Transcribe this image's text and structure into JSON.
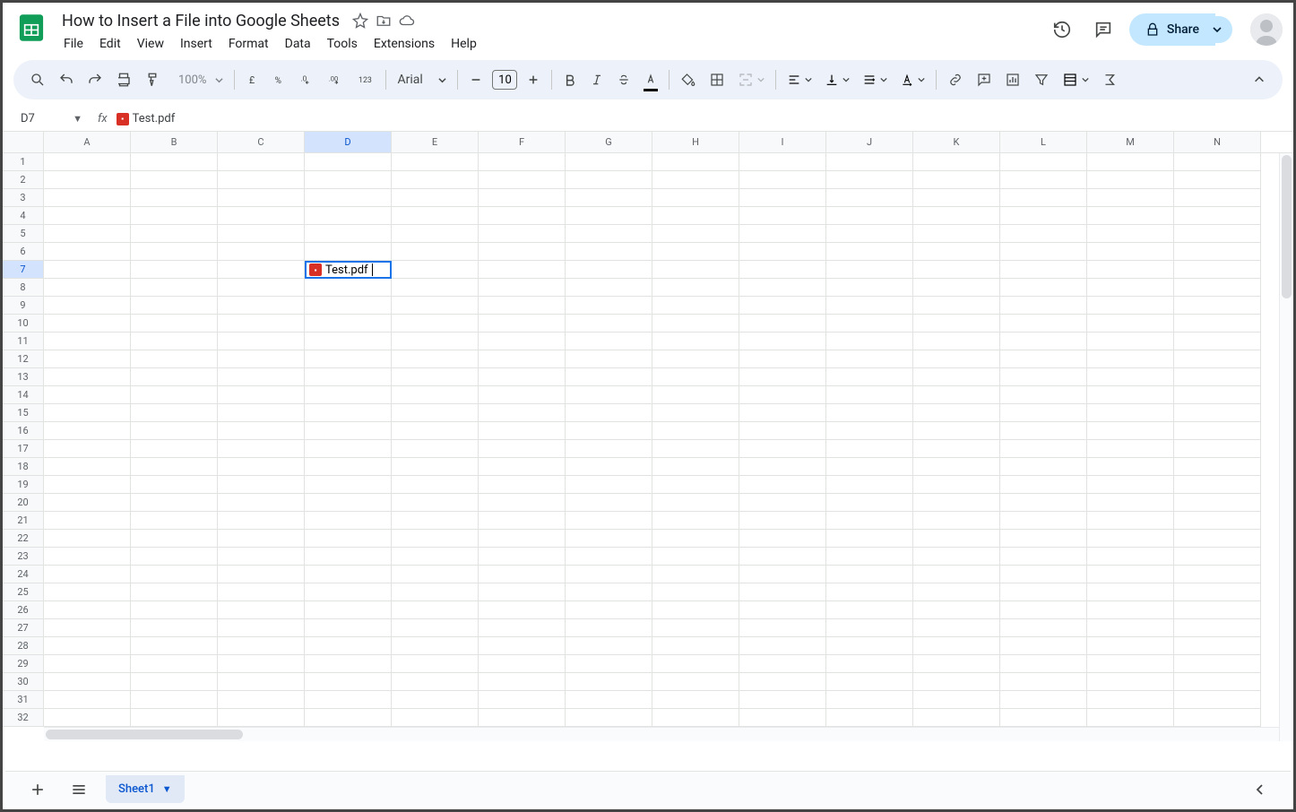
{
  "header": {
    "doc_title": "How to Insert a File into Google Sheets",
    "menus": [
      "File",
      "Edit",
      "View",
      "Insert",
      "Format",
      "Data",
      "Tools",
      "Extensions",
      "Help"
    ],
    "share_label": "Share"
  },
  "toolbar": {
    "zoom": "100%",
    "font_name": "Arial",
    "font_size": "10"
  },
  "formula_bar": {
    "name_box": "D7",
    "cell_content": "Test.pdf"
  },
  "grid": {
    "columns": [
      "A",
      "B",
      "C",
      "D",
      "E",
      "F",
      "G",
      "H",
      "I",
      "J",
      "K",
      "L",
      "M",
      "N"
    ],
    "selected_column": "D",
    "row_count": 32,
    "selected_row": 7,
    "active_cell": {
      "col": "D",
      "row": 7,
      "text": "Test.pdf"
    }
  },
  "sheet_tabs": {
    "active": "Sheet1"
  }
}
